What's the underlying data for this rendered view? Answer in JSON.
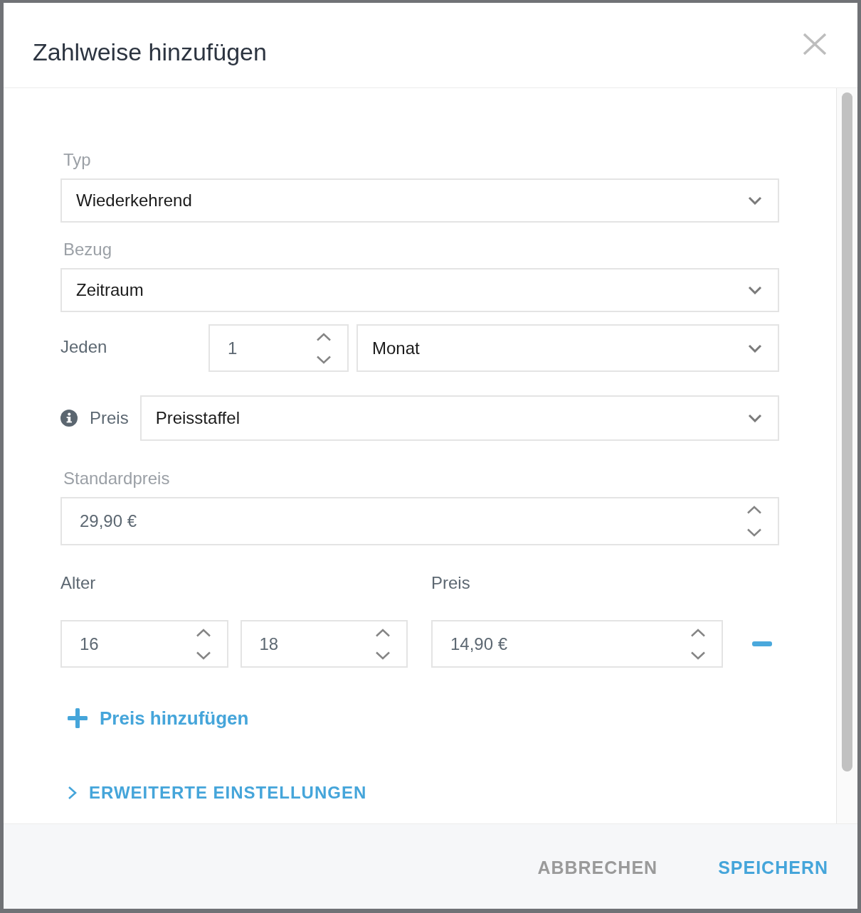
{
  "dialog": {
    "title": "Zahlweise hinzufügen"
  },
  "fields": [
    {
      "kind": "select",
      "label": "Typ",
      "value": "Wiederkehrend"
    },
    {
      "kind": "select",
      "label": "Bezug",
      "value": "Zeitraum"
    },
    {
      "kind": "interval",
      "label": "Jeden",
      "count": "1",
      "unit": "Monat"
    },
    {
      "kind": "inline_select",
      "label": "Preis",
      "info": true,
      "value": "Preisstaffel"
    },
    {
      "kind": "number",
      "label": "Standardpreis",
      "value": "29,90 €"
    }
  ],
  "price_tiers": {
    "age_label": "Alter",
    "price_label": "Preis",
    "rows": [
      {
        "age_from": "16",
        "age_to": "18",
        "price": "14,90 €"
      }
    ]
  },
  "add_price": {
    "label": "Preis hinzufügen"
  },
  "advanced": {
    "label": "ERWEITERTE EINSTELLUNGEN",
    "expanded": false
  },
  "footer": {
    "buttons": [
      {
        "kind": "secondary",
        "label": "ABBRECHEN"
      },
      {
        "kind": "primary",
        "label": "SPEICHERN"
      }
    ]
  }
}
